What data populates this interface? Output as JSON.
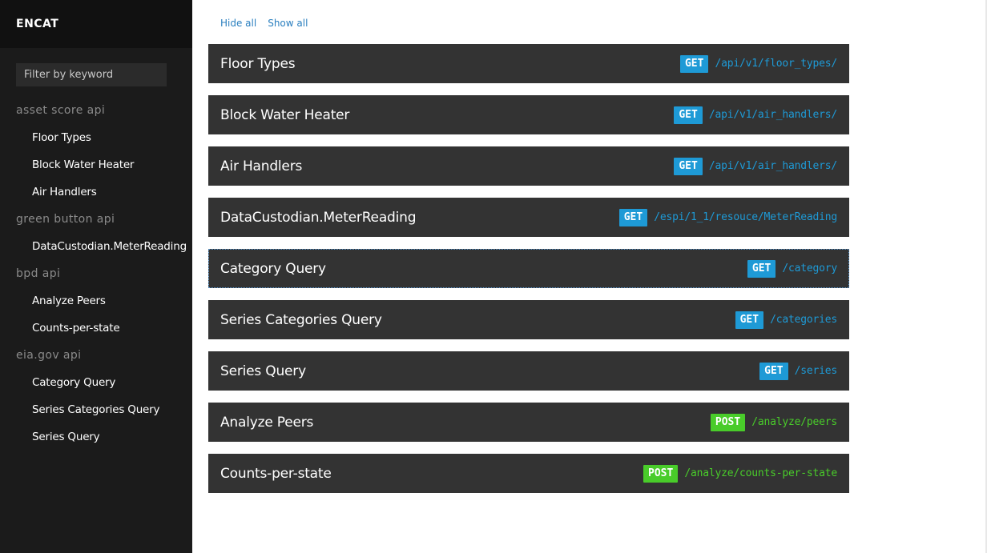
{
  "app": {
    "brand": "ENCAT",
    "filter_placeholder": "Filter by keyword"
  },
  "colors": {
    "get": "#1e9ad6",
    "post": "#49cc2a"
  },
  "sidebar": {
    "groups": [
      {
        "title": "asset score api",
        "items": [
          "Floor Types",
          "Block Water Heater",
          "Air Handlers"
        ]
      },
      {
        "title": "green button api",
        "items": [
          "DataCustodian.MeterReading"
        ]
      },
      {
        "title": "bpd api",
        "items": [
          "Analyze Peers",
          "Counts-per-state"
        ]
      },
      {
        "title": "eia.gov api",
        "items": [
          "Category Query",
          "Series Categories Query",
          "Series Query"
        ]
      }
    ]
  },
  "toolbar": {
    "hide_all": "Hide all",
    "show_all": "Show all"
  },
  "endpoints": [
    {
      "title": "Floor Types",
      "method": "GET",
      "path": "/api/v1/floor_types/"
    },
    {
      "title": "Block Water Heater",
      "method": "GET",
      "path": "/api/v1/air_handlers/"
    },
    {
      "title": "Air Handlers",
      "method": "GET",
      "path": "/api/v1/air_handlers/"
    },
    {
      "title": "DataCustodian.MeterReading",
      "method": "GET",
      "path": "/espi/1_1/resouce/MeterReading"
    },
    {
      "title": "Category Query",
      "method": "GET",
      "path": "/category"
    },
    {
      "title": "Series Categories Query",
      "method": "GET",
      "path": "/categories"
    },
    {
      "title": "Series Query",
      "method": "GET",
      "path": "/series"
    },
    {
      "title": "Analyze Peers",
      "method": "POST",
      "path": "/analyze/peers"
    },
    {
      "title": "Counts-per-state",
      "method": "POST",
      "path": "/analyze/counts-per-state"
    }
  ]
}
